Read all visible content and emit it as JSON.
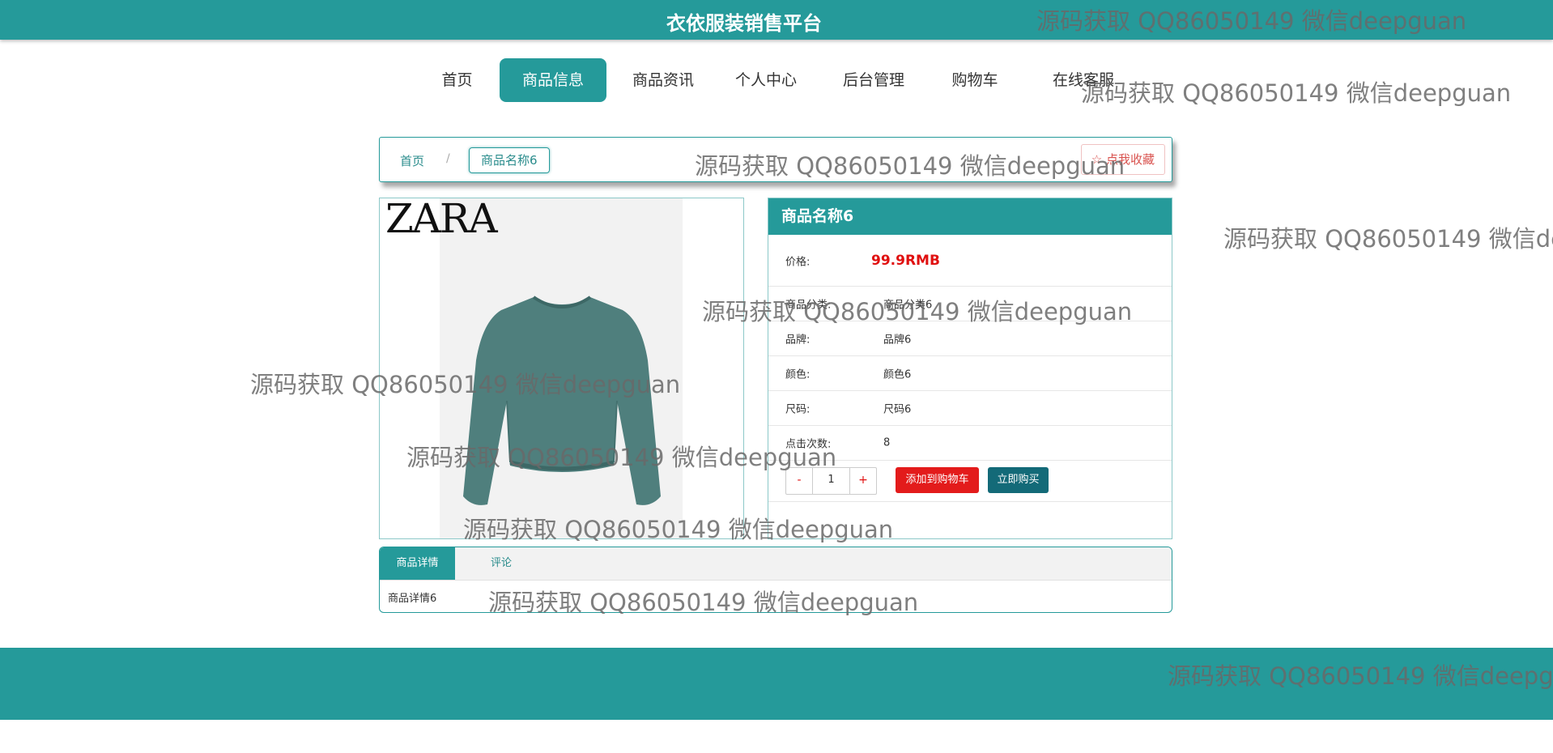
{
  "header": {
    "title": "衣依服装销售平台"
  },
  "nav": {
    "items": [
      {
        "label": "首页"
      },
      {
        "label": "商品信息"
      },
      {
        "label": "商品资讯"
      },
      {
        "label": "个人中心"
      },
      {
        "label": "后台管理"
      },
      {
        "label": "购物车"
      },
      {
        "label": "在线客服"
      }
    ],
    "active_index": 1
  },
  "breadcrumb": {
    "home": "首页",
    "separator": "/",
    "current": "商品名称6"
  },
  "favorite": {
    "label": "☆ 点我收藏"
  },
  "product_image": {
    "brand_logo": "ZARA",
    "subject": "sweater"
  },
  "product": {
    "name": "商品名称6",
    "price_label": "价格:",
    "price_value": "99.9RMB",
    "category_label": "商品分类:",
    "category_value": "商品分类6",
    "brand_label": "品牌:",
    "brand_value": "品牌6",
    "color_label": "颜色:",
    "color_value": "颜色6",
    "size_label": "尺码:",
    "size_value": "尺码6",
    "clicks_label": "点击次数:",
    "clicks_value": "8"
  },
  "quantity": {
    "minus": "-",
    "value": "1",
    "plus": "+"
  },
  "actions": {
    "add_to_cart": "添加到购物车",
    "buy_now": "立即购买"
  },
  "tabs": {
    "details": "商品详情",
    "comments": "评论"
  },
  "details": {
    "text": "商品详情6"
  },
  "watermark": "源码获取 QQ86050149 微信deepguan",
  "colors": {
    "primary": "#259a9a",
    "price": "#e01010",
    "cart_button": "#e31b1b",
    "buy_button": "#136a78"
  }
}
